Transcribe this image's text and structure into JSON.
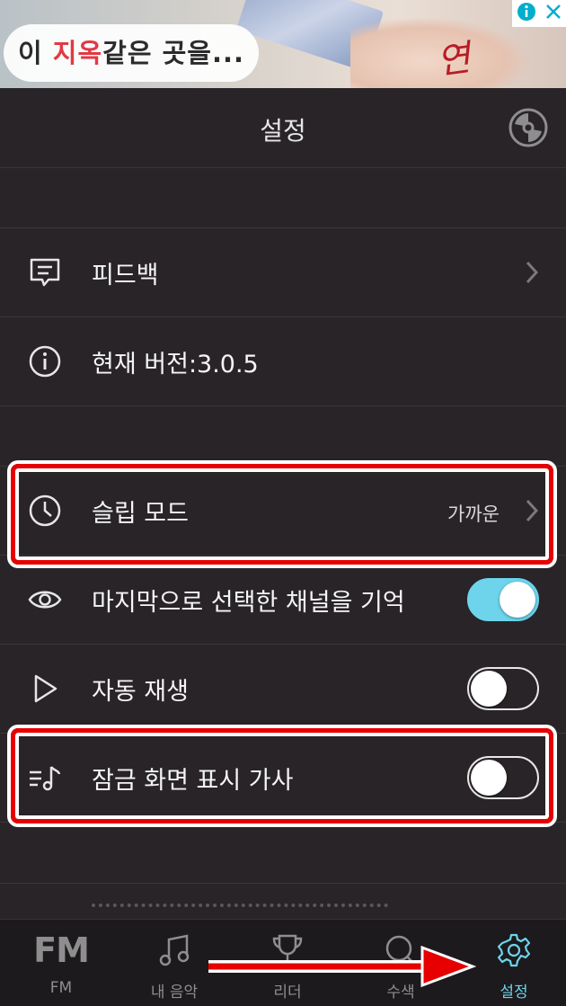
{
  "ad": {
    "text_prefix": "이 ",
    "text_highlight": "지옥",
    "text_suffix": "같은 곳을...",
    "logo_text": "연",
    "info_icon": "info-icon",
    "close_icon": "close-icon"
  },
  "header": {
    "title": "설정",
    "right_icon": "disc-icon"
  },
  "settings": {
    "feedback": {
      "label": "피드백",
      "icon": "message-icon"
    },
    "version": {
      "label": "현재 버전:3.0.5",
      "icon": "info-circle-icon"
    },
    "sleep_mode": {
      "label": "슬립 모드",
      "value": "가까운",
      "icon": "clock-icon"
    },
    "remember_channel": {
      "label": "마지막으로 선택한 채널을 기억",
      "icon": "eye-icon",
      "on": true
    },
    "autoplay": {
      "label": "자동 재생",
      "icon": "play-icon",
      "on": false
    },
    "lockscreen_lyrics": {
      "label": "잠금 화면 표시 가사",
      "icon": "lyrics-icon",
      "on": false
    }
  },
  "tabs": [
    {
      "glyph": "FM",
      "label": "FM",
      "icon": "fm-icon",
      "active": false
    },
    {
      "label": "내 음악",
      "icon": "music-note-icon",
      "active": false
    },
    {
      "label": "리더",
      "icon": "trophy-icon",
      "active": false
    },
    {
      "label": "수색",
      "icon": "search-icon",
      "active": false
    },
    {
      "label": "설정",
      "icon": "gear-icon",
      "active": true
    }
  ],
  "colors": {
    "accent": "#6dd4ec",
    "annotation_red": "#e60000",
    "background": "#282428"
  }
}
